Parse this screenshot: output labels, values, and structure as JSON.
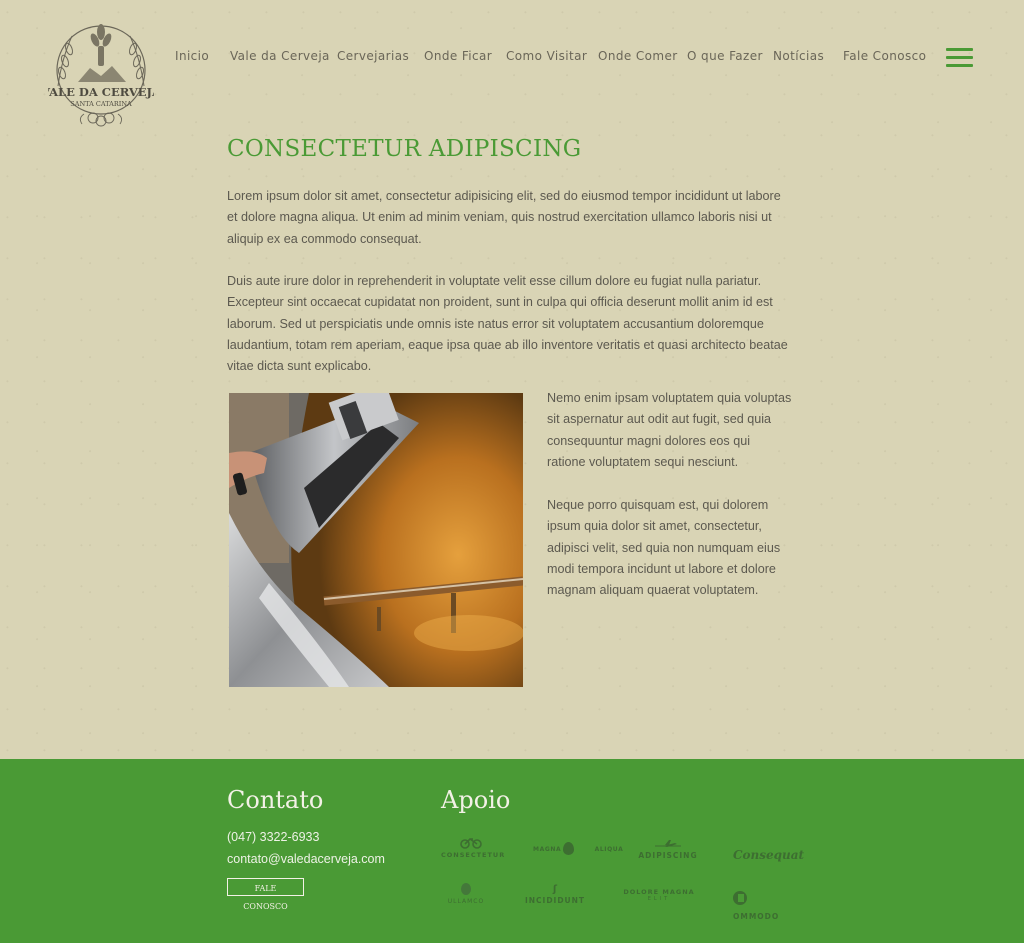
{
  "header": {
    "logo_text": {
      "line1": "VALE DA CERVEJA",
      "line2": "SANTA CATARINA"
    },
    "nav": [
      {
        "label": "Inicio"
      },
      {
        "label": "Vale da Cerveja"
      },
      {
        "label": "Cervejarias"
      },
      {
        "label": "Onde Ficar"
      },
      {
        "label": "Como Visitar"
      },
      {
        "label": "Onde Comer"
      },
      {
        "label": "O que Fazer"
      },
      {
        "label": "Notícias"
      },
      {
        "label": "Fale Conosco"
      }
    ],
    "menu_icon": "hamburger-icon"
  },
  "main": {
    "title": "CONSECTETUR ADIPISCING",
    "paragraphs": [
      "Lorem ipsum dolor sit amet, consectetur adipisicing elit, sed do eiusmod tempor incididunt ut labore et dolore magna aliqua. Ut enim ad minim veniam, quis nostrud exercitation ullamco laboris nisi ut aliquip ex ea commodo consequat.",
      "Duis aute irure dolor in reprehenderit in voluptate velit esse cillum dolore eu fugiat nulla pariatur. Excepteur sint occaecat cupidatat non proident, sunt in culpa qui officia deserunt mollit anim id est laborum. Sed ut perspiciatis unde omnis iste natus error sit voluptatem accusantium doloremque laudantium, totam rem aperiam, eaque ipsa quae ab illo inventore veritatis et quasi architecto beatae vitae dicta sunt explicabo.",
      "Nemo enim ipsam voluptatem quia voluptas sit aspernatur aut odit aut fugit, sed quia consequuntur magni dolores eos qui ratione voluptatem sequi nesciunt.",
      "Neque porro quisquam est, qui dolorem ipsum quia dolor sit amet, consectetur, adipisci velit, sed quia non numquam eius modi tempora incidunt ut labore et dolore magnam aliquam quaerat voluptatem."
    ]
  },
  "footer": {
    "contact_title": "Contato",
    "phone": "(047) 3322-6933",
    "email": "contato@valedacerveja.com",
    "contact_button": "FALE CONOSCO",
    "support_title": "Apoio",
    "sponsors": [
      {
        "label": "CONSECTETUR",
        "icon": "bicycle-icon"
      },
      {
        "label": "MAGNA  ALIQUA",
        "icon": "drop-icon"
      },
      {
        "label": "ADIPISCING",
        "icon": "plane-icon"
      },
      {
        "label": "Consequat",
        "icon": ""
      },
      {
        "label": "ULLAMCO",
        "icon": "circle-icon"
      },
      {
        "label": "INCIDIDUNT",
        "icon": "link-icon"
      },
      {
        "label": "DOLORE MAGNA",
        "sub": "ELIT",
        "icon": ""
      },
      {
        "label": "OMMODO",
        "icon": "circle-c-icon"
      }
    ]
  },
  "colors": {
    "background": "#d9d4b5",
    "accent_green": "#4a9a35",
    "body_text": "#5c594f"
  }
}
